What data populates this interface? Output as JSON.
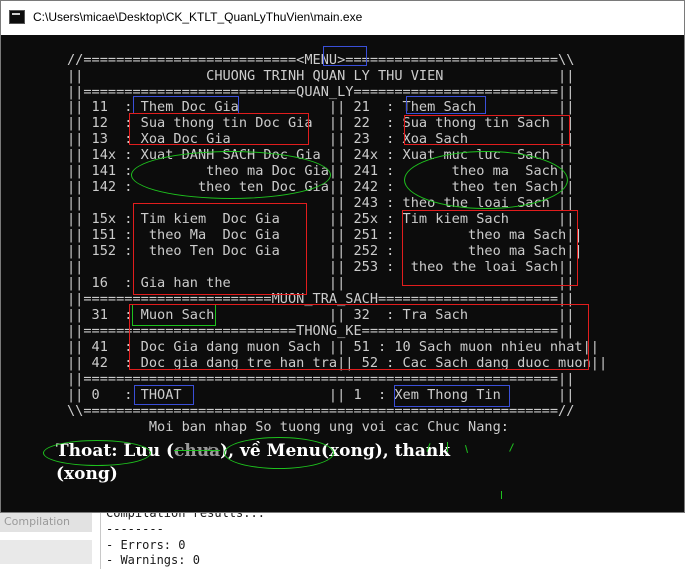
{
  "window": {
    "title": "C:\\Users\\micae\\Desktop\\CK_KTLT_QuanLyThuVien\\main.exe"
  },
  "console": {
    "lines": [
      "//==========================<MENU>==========================\\\\",
      "||               CHUONG TRINH QUAN LY THU VIEN              ||",
      "||==========================QUAN_LY=========================||",
      "|| 11  : Them Doc Gia           || 21  : Them Sach          ||",
      "|| 12  : Sua thong tin Doc Gia  || 22  : Sua thong tin Sach ||",
      "|| 13  : Xoa Doc Gia            || 23  : Xoa Sach           ||",
      "|| 14x : Xuat DANH SACH Doc Gia || 24x : Xuat muc luc  Sach ||",
      "|| 141 :         theo ma Doc Gia|| 241 :       theo ma  Sach||",
      "|| 142 :        theo ten Doc Gia|| 242 :       theo ten Sach||",
      "||                              || 243 : theo the loai Sach ||",
      "|| 15x : Tim kiem  Doc Gia      || 25x : Tim kiem Sach      ||",
      "|| 151 :  theo Ma  Doc Gia      || 251 :         theo ma Sach||",
      "|| 152 :  theo Ten Doc Gia      || 252 :         theo ma Sach||",
      "||                              || 253 :  theo the loai Sach||",
      "|| 16  : Gia han the            ||                          ||",
      "||=======================MUON_TRA_SACH======================||",
      "|| 31  : Muon Sach              || 32  : Tra Sach           ||",
      "||==========================THONG_KE========================||",
      "|| 41  : Doc Gia dang muon Sach || 51 : 10 Sach muon nhieu nhat||",
      "|| 42  : Doc gia dang tre han tra|| 52 : Cac Sach dang duoc muon||",
      "||==========================================================||",
      "|| 0   : THOAT                  || 1  : Xem Thong Tin       ||",
      "\\\\==========================================================//",
      "          Moi ban nhap So tuong ung voi cac Chuc Nang:"
    ]
  },
  "note": {
    "line1_a": "Thoat: Luu (",
    "line1_struck": "chưa",
    "line1_b": "), về Menu(xong), thank",
    "line2": "(xong)"
  },
  "ide": {
    "tab_label": "Compilation",
    "lines": [
      "Compilation results...",
      "--------",
      "- Errors: 0",
      "- Warnings: 0"
    ]
  },
  "colors": {
    "console_bg": "#0c0c0c",
    "console_text": "#cccccc",
    "box_blue": "#3a4fd8",
    "box_red": "#e11d1d",
    "box_green": "#1ec21e"
  }
}
